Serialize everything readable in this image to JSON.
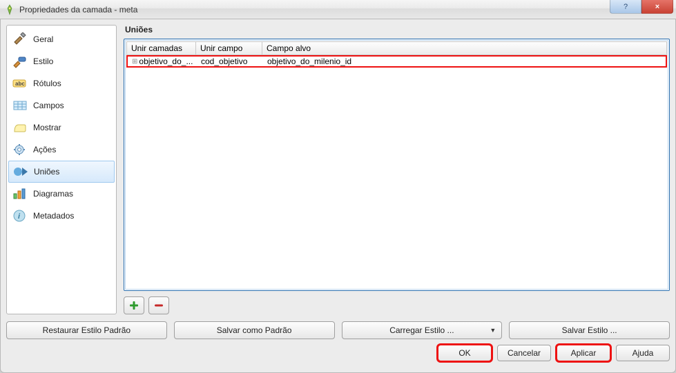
{
  "window": {
    "title": "Propriedades da camada - meta"
  },
  "sidebar": {
    "items": [
      {
        "label": "Geral"
      },
      {
        "label": "Estilo"
      },
      {
        "label": "Rótulos"
      },
      {
        "label": "Campos"
      },
      {
        "label": "Mostrar"
      },
      {
        "label": "Ações"
      },
      {
        "label": "Uniões"
      },
      {
        "label": "Diagramas"
      },
      {
        "label": "Metadados"
      }
    ]
  },
  "panel": {
    "title": "Uniões",
    "columns": {
      "c1": "Unir camadas",
      "c2": "Unir campo",
      "c3": "Campo alvo"
    },
    "row": {
      "c1": "objetivo_do_...",
      "c2": "cod_objetivo",
      "c3": "objetivo_do_milenio_id"
    }
  },
  "buttons": {
    "add": "+",
    "remove": "—",
    "restore": "Restaurar Estilo Padrão",
    "saveDefault": "Salvar como Padrão",
    "loadStyle": "Carregar Estilo ...",
    "saveStyle": "Salvar Estilo ...",
    "ok": "OK",
    "cancel": "Cancelar",
    "apply": "Aplicar",
    "help": "Ajuda"
  }
}
